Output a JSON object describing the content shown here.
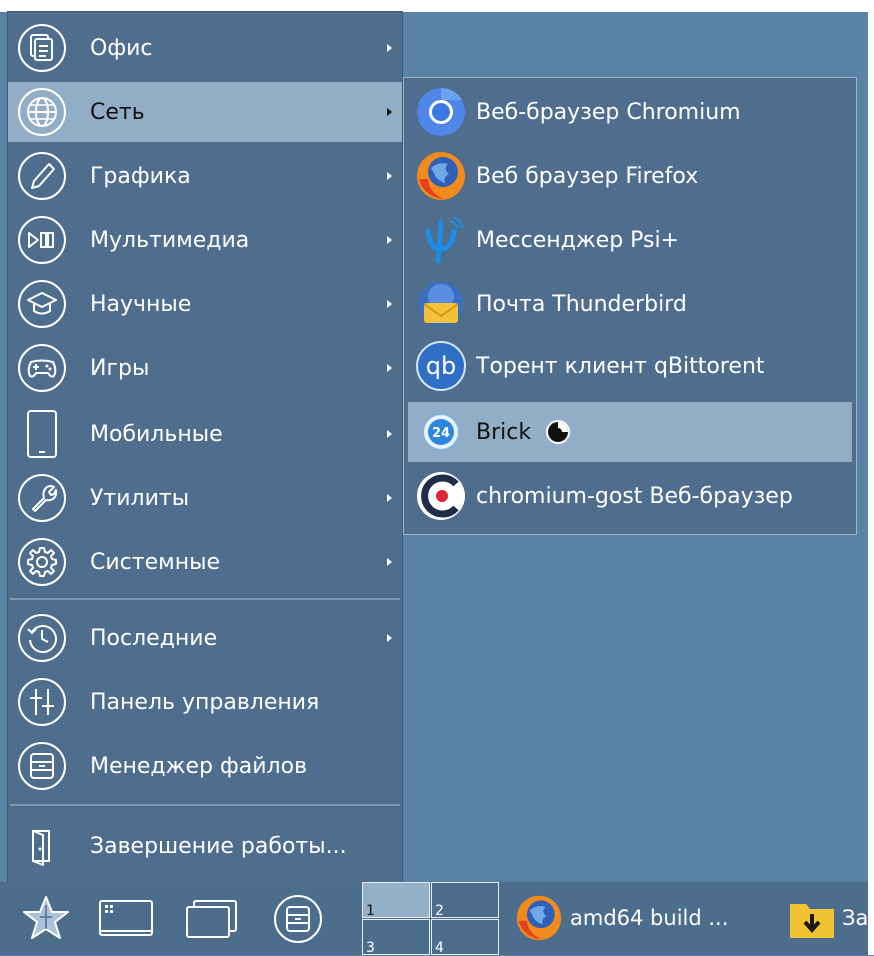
{
  "main_menu": {
    "items": [
      {
        "label": "Офис",
        "icon": "office-icon",
        "submenu": true
      },
      {
        "label": "Сеть",
        "icon": "network-globe-icon",
        "submenu": true,
        "active": true
      },
      {
        "label": "Графика",
        "icon": "graphics-pencil-icon",
        "submenu": true
      },
      {
        "label": "Мультимедиа",
        "icon": "multimedia-play-icon",
        "submenu": true
      },
      {
        "label": "Научные",
        "icon": "science-mortarboard-icon",
        "submenu": true
      },
      {
        "label": "Игры",
        "icon": "games-gamepad-icon",
        "submenu": true
      },
      {
        "label": "Мобильные",
        "icon": "mobile-tablet-icon",
        "submenu": true
      },
      {
        "label": "Утилиты",
        "icon": "utilities-wrench-icon",
        "submenu": true
      },
      {
        "label": "Системные",
        "icon": "system-gear-icon",
        "submenu": true
      }
    ],
    "extra_items": [
      {
        "label": "Последние",
        "icon": "recent-clock-icon",
        "submenu": true
      },
      {
        "label": "Панель управления",
        "icon": "control-panel-sliders-icon",
        "submenu": false
      },
      {
        "label": "Менеджер файлов",
        "icon": "file-manager-cabinet-icon",
        "submenu": false
      }
    ],
    "shutdown": {
      "label": "Завершение работы...",
      "icon": "shutdown-door-icon"
    }
  },
  "network_submenu": {
    "items": [
      {
        "label": "Веб-браузер Chromium",
        "icon": "chromium-icon"
      },
      {
        "label": "Веб браузер Firefox",
        "icon": "firefox-icon"
      },
      {
        "label": "Мессенджер Psi+",
        "icon": "psi-plus-icon"
      },
      {
        "label": "Почта Thunderbird",
        "icon": "thunderbird-icon"
      },
      {
        "label": "Торент клиент qBittorent",
        "icon": "qbittorrent-icon"
      },
      {
        "label": "Brick",
        "icon": "brick-24-icon",
        "active": true
      },
      {
        "label": "chromium-gost Веб-браузер",
        "icon": "chromium-gost-icon"
      }
    ]
  },
  "taskbar": {
    "buttons": [
      {
        "name": "start-menu-star",
        "icon": "star-icon"
      },
      {
        "name": "show-desktop",
        "icon": "desktop-icon"
      },
      {
        "name": "windows",
        "icon": "windows-icon"
      },
      {
        "name": "file-manager",
        "icon": "file-manager-cabinet-icon"
      }
    ],
    "pager": [
      "1",
      "2",
      "3",
      "4"
    ],
    "current_desktop": "1",
    "tasks": [
      {
        "label": "amd64 build ...",
        "icon": "firefox-icon"
      },
      {
        "label": "За",
        "icon": "downloads-folder-icon"
      }
    ]
  },
  "colors": {
    "desktop": "#5a82a4",
    "menu_bg": "#4f6e8d",
    "highlight": "#91aec6",
    "text": "#ffffff"
  }
}
